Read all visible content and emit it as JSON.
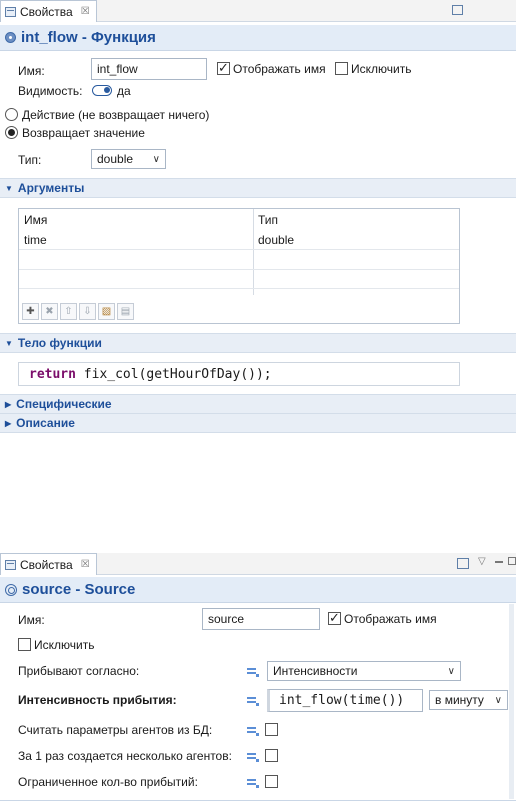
{
  "panel1": {
    "tab_label": "Свойства",
    "tab_close": "☒",
    "title": "int_flow - Функция",
    "name_label": "Имя:",
    "name_value": "int_flow",
    "show_name_label": "Отображать имя",
    "show_name_checked": true,
    "exclude_label": "Исключить",
    "exclude_checked": false,
    "visibility_label": "Видимость:",
    "visibility_value": "да",
    "radio_action_label": "Действие (не возвращает ничего)",
    "radio_return_label": "Возвращает значение",
    "type_label": "Тип:",
    "type_value": "double",
    "args_section": "Аргументы",
    "args_table": {
      "headers": [
        "Имя",
        "Тип"
      ],
      "rows": [
        [
          "time",
          "double"
        ],
        [
          "",
          ""
        ],
        [
          "",
          ""
        ]
      ]
    },
    "body_section": "Тело функции",
    "code_keyword": "return",
    "code_rest": " fix_col(getHourOfDay());",
    "specific_section": "Специфические",
    "description_section": "Описание"
  },
  "panel2": {
    "tab_label": "Свойства",
    "tab_close": "☒",
    "title": "source - Source",
    "name_label": "Имя:",
    "name_value": "source",
    "show_name_label": "Отображать имя",
    "exclude_label": "Исключить",
    "arrive_label": "Прибывают согласно:",
    "arrive_value": "Интенсивности",
    "rate_label": "Интенсивность прибытия:",
    "rate_value": "int_flow(time())",
    "rate_unit": "в минуту",
    "db_params_label": "Считать параметры агентов из БД:",
    "multiple_label": "За 1 раз создается несколько агентов:",
    "limited_label": "Ограниченное кол-во прибытий:"
  },
  "colors": {
    "accent": "#1e4f9a",
    "section_bg": "#e8eef6",
    "title_bg": "#e3ecf7",
    "keyword": "#7b0d6a"
  }
}
